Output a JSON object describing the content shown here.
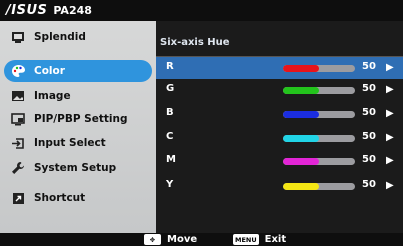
{
  "titlebar": {
    "brand": "/ISUS",
    "model": "PA248"
  },
  "sidebar": {
    "items": [
      {
        "label": "Splendid",
        "icon": "splendid-icon",
        "selected": false
      },
      {
        "label": "Color",
        "icon": "color-palette-icon",
        "selected": true
      },
      {
        "label": "Image",
        "icon": "image-icon",
        "selected": false
      },
      {
        "label": "PIP/PBP Setting",
        "icon": "pip-icon",
        "selected": false
      },
      {
        "label": "Input Select",
        "icon": "input-select-icon",
        "selected": false
      },
      {
        "label": "System Setup",
        "icon": "wrench-icon",
        "selected": false
      },
      {
        "label": "Shortcut",
        "icon": "shortcut-icon",
        "selected": false
      }
    ]
  },
  "content": {
    "header": "Six-axis Hue",
    "rows": [
      {
        "label": "R",
        "value": "50",
        "level": 0.5,
        "color": "#e8141b",
        "selected": true
      },
      {
        "label": "G",
        "value": "50",
        "level": 0.5,
        "color": "#23c41c",
        "selected": false
      },
      {
        "label": "B",
        "value": "50",
        "level": 0.5,
        "color": "#1b2de0",
        "selected": false
      },
      {
        "label": "C",
        "value": "50",
        "level": 0.5,
        "color": "#21d4e6",
        "selected": false
      },
      {
        "label": "M",
        "value": "50",
        "level": 0.5,
        "color": "#e325d6",
        "selected": false
      },
      {
        "label": "Y",
        "value": "50",
        "level": 0.5,
        "color": "#f4e614",
        "selected": false
      }
    ]
  },
  "footer": {
    "move_key": "✥",
    "move_label": "Move",
    "exit_key": "MENU",
    "exit_label": "Exit"
  },
  "colors": {
    "accent": "#2f94dd",
    "row_highlight": "#2f6eb4",
    "background": "#1b1b1b"
  }
}
